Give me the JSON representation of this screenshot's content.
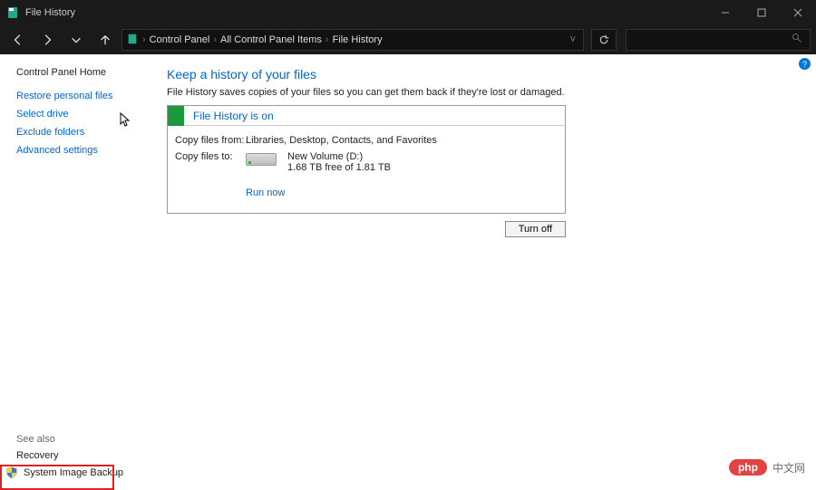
{
  "window": {
    "title": "File History"
  },
  "breadcrumb": {
    "a": "Control Panel",
    "b": "All Control Panel Items",
    "c": "File History"
  },
  "sidebar": {
    "home": "Control Panel Home",
    "links": [
      "Restore personal files",
      "Select drive",
      "Exclude folders",
      "Advanced settings"
    ]
  },
  "main": {
    "heading": "Keep a history of your files",
    "desc": "File History saves copies of your files so you can get them back if they're lost or damaged.",
    "status_label": "File History is on",
    "copy_from_label": "Copy files from:",
    "copy_from_value": "Libraries, Desktop, Contacts, and Favorites",
    "copy_to_label": "Copy files to:",
    "drive_name": "New Volume (D:)",
    "drive_free": "1.68 TB free of 1.81 TB",
    "run_now": "Run now",
    "turn_off": "Turn off"
  },
  "bottom": {
    "see_also": "See also",
    "recovery": "Recovery",
    "sib": "System Image Backup"
  },
  "watermark": {
    "pill": "php",
    "txt": "中文网"
  }
}
